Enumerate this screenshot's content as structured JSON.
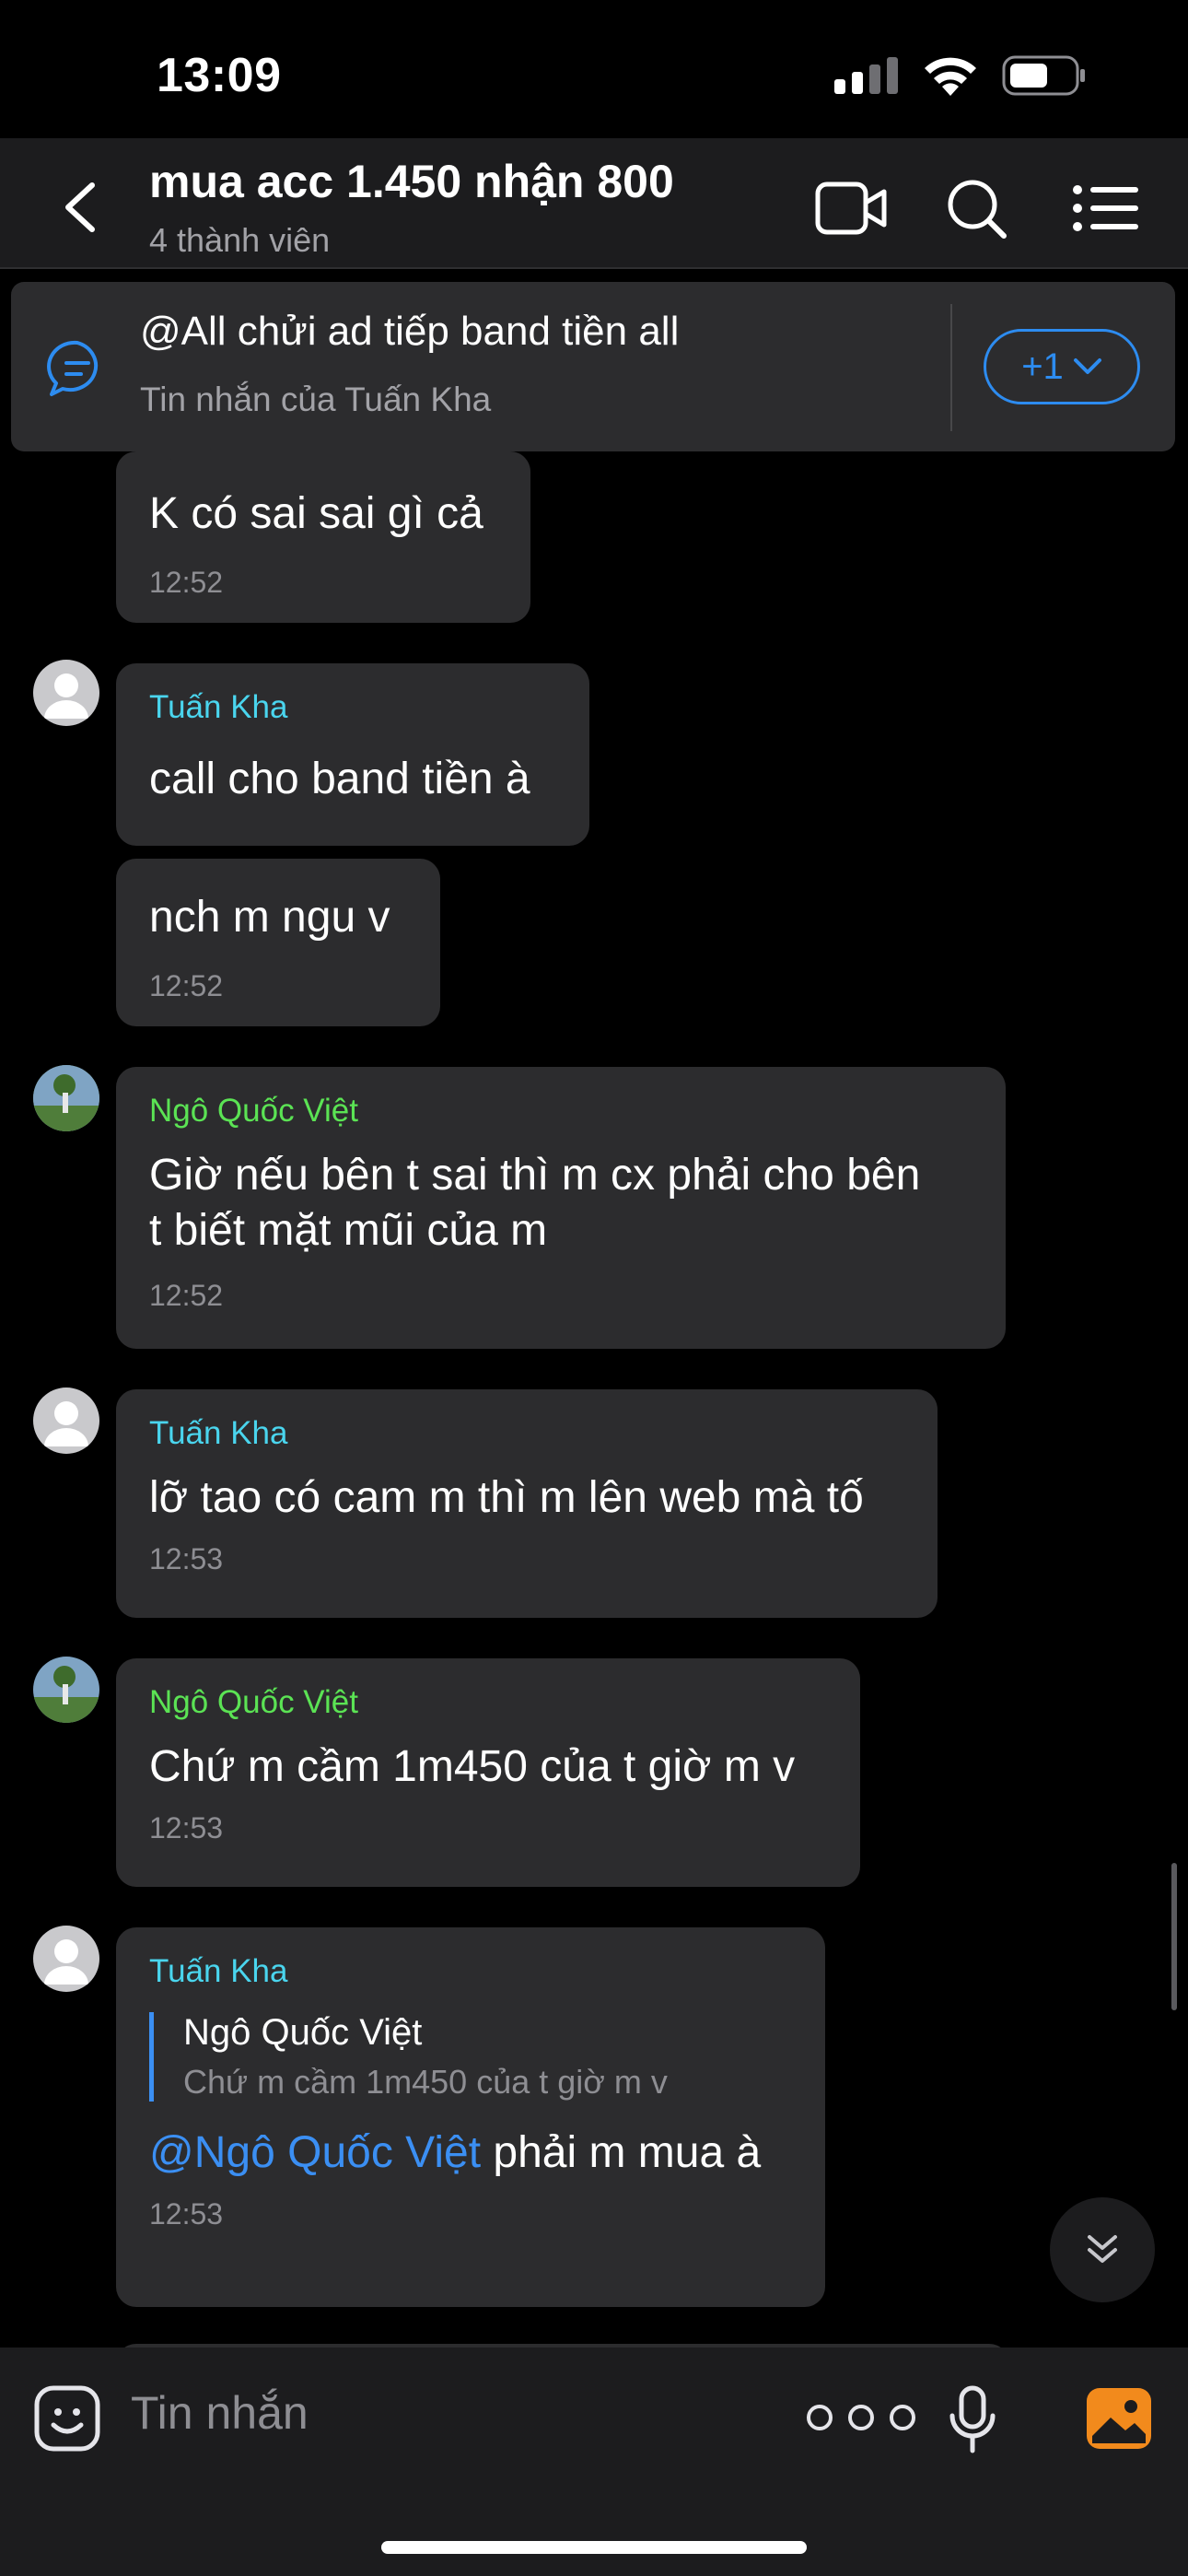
{
  "status_bar": {
    "time": "13:09"
  },
  "header": {
    "title": "mua acc 1.450 nhận 800",
    "subtitle": "4 thành viên"
  },
  "pinned": {
    "text": "@All chửi ad tiếp band tiền all",
    "subtext": "Tin nhắn của Tuấn Kha",
    "more_label": "+1"
  },
  "messages": [
    {
      "text": "K có sai sai gì cả",
      "time": "12:52"
    },
    {
      "sender": "Tuấn Kha",
      "text": "call cho band tiền à"
    },
    {
      "text": "nch m ngu v",
      "time": "12:52"
    },
    {
      "sender": "Ngô Quốc Việt",
      "text_line1": "Giờ nếu bên t sai thì m cx phải cho bên",
      "text_line2": "t biết mặt mũi của m",
      "time": "12:52"
    },
    {
      "sender": "Tuấn Kha",
      "text": "lỡ tao có cam m thì m lên web mà tố",
      "time": "12:53"
    },
    {
      "sender": "Ngô Quốc Việt",
      "text": "Chứ m cầm 1m450 của t giờ m v",
      "time": "12:53"
    },
    {
      "sender": "Tuấn Kha",
      "quote_name": "Ngô Quốc Việt",
      "quote_text": "Chứ m cầm 1m450 của t giờ m v",
      "mention": "@Ngô Quốc Việt",
      "text": " phải m mua à",
      "time": "12:53"
    }
  ],
  "input": {
    "placeholder": "Tin nhắn"
  },
  "colors": {
    "accent": "#2d8cf0",
    "cyan_name": "#4ad5ee",
    "green_name": "#5be354",
    "bubble": "#2c2c2e",
    "media_icon": "#f28a1c"
  }
}
